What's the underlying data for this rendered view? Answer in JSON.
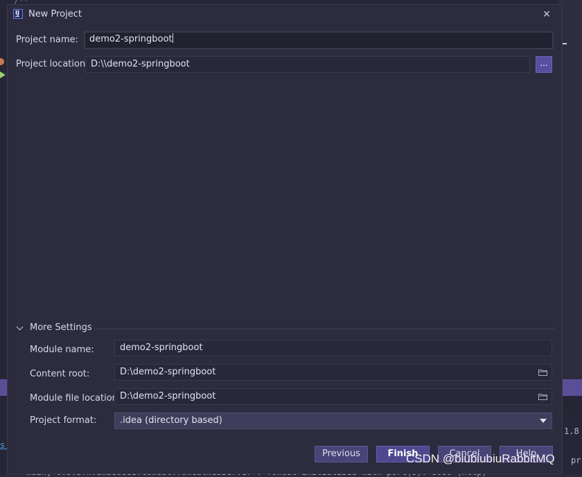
{
  "background": {
    "code_top": "/**",
    "right_text": "1.8",
    "right_text2": "pr",
    "left_link": "s:",
    "log_line": "main] o.s.b.w.embedded.tomcat.TomcatWebServer  : Tomcat initialized with port(s): 8080 (http)"
  },
  "dialog": {
    "title": "New Project",
    "close_glyph": "✕",
    "project_name_label": "Project name:",
    "project_name_value": "demo2-springboot",
    "project_location_label": "Project location:",
    "project_location_value": "D:\\\\demo2-springboot",
    "browse_label": "...",
    "more_settings_label": "More Settings",
    "module_name_label": "Module name:",
    "module_name_value": "demo2-springboot",
    "content_root_label": "Content root:",
    "content_root_value": "D:\\demo2-springboot",
    "module_file_location_label": "Module file location:",
    "module_file_location_value": "D:\\demo2-springboot",
    "project_format_label": "Project format:",
    "project_format_value": ".idea (directory based)",
    "buttons": {
      "previous": "Previous",
      "finish": "Finish",
      "cancel": "Cancel",
      "help": "Help"
    }
  },
  "watermark": "CSDN @biubiubiuRabbitMQ",
  "colors": {
    "dialog_bg": "#2c2c3e",
    "accent": "#574fa0",
    "ide_purple_bar": "#5a4f97"
  },
  "icons": [
    "app-icon",
    "close-icon",
    "chevron-down-icon",
    "folder-icon",
    "dropdown-arrow-icon"
  ]
}
